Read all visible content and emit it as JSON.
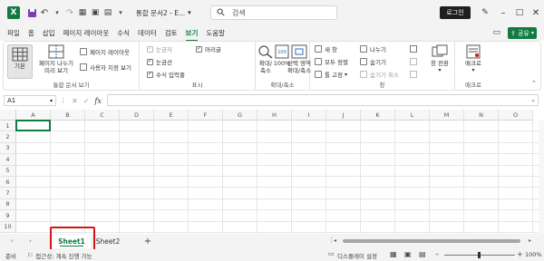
{
  "app": {
    "logo_letter": "X",
    "brand_color": "#107c41"
  },
  "titlebar": {
    "doc_title": "통합 문서2 - E...",
    "search_placeholder": "검색",
    "login_label": "로그인"
  },
  "menu": {
    "tabs": [
      "파일",
      "홈",
      "삽입",
      "페이지 레이아웃",
      "수식",
      "데이터",
      "검토",
      "보기",
      "도움말"
    ],
    "active_tab": "보기",
    "share_label": "공유"
  },
  "ribbon": {
    "workbook_views": {
      "label": "통합 문서 보기",
      "normal": "기본",
      "page_break": "페이지 나누기\n미리 보기",
      "page_layout": "페이지 레이아웃",
      "custom_views": "사용자 지정 보기"
    },
    "show": {
      "label": "표시",
      "ruler": "눈금자",
      "gridlines": "눈금선",
      "formula_bar": "수식 입력줄",
      "headings": "머리글"
    },
    "zoom": {
      "label": "확대/축소",
      "zoom": "확대/\n축소",
      "hundred": "100%",
      "zoom_selection": "선택 영역\n확대/축소"
    },
    "window": {
      "label": "창",
      "new_window": "새 창",
      "arrange_all": "모두 정렬",
      "freeze": "틀 고정",
      "split": "나누기",
      "hide": "숨기기",
      "unhide": "숨기기 취소",
      "switch": "창 전환"
    },
    "macros": {
      "label": "매크로",
      "macros": "매크로"
    }
  },
  "formula_bar": {
    "name_box": "A1",
    "fx": "fx"
  },
  "grid": {
    "columns": [
      "A",
      "B",
      "C",
      "D",
      "E",
      "F",
      "G",
      "H",
      "I",
      "J",
      "K",
      "L",
      "M",
      "N",
      "O"
    ],
    "rows": [
      "1",
      "2",
      "3",
      "4",
      "5",
      "6",
      "7",
      "8",
      "9",
      "10"
    ],
    "active_cell": "A1"
  },
  "sheets": {
    "tabs": [
      "Sheet1",
      "Sheet2"
    ],
    "active": "Sheet1",
    "add": "+"
  },
  "status": {
    "ready": "준비",
    "accessibility": "접근성: 계속 진행 가능",
    "display_settings": "디스플레이 설정",
    "zoom": "100%"
  }
}
